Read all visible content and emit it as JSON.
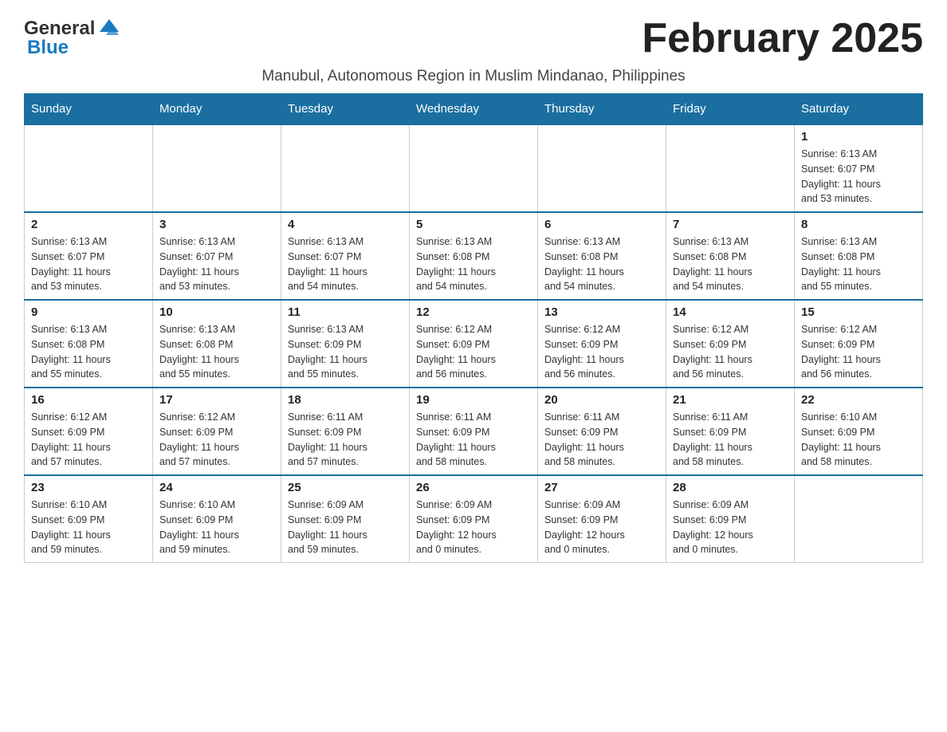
{
  "header": {
    "logo_general": "General",
    "logo_blue": "Blue",
    "month_year": "February 2025",
    "subtitle": "Manubul, Autonomous Region in Muslim Mindanao, Philippines"
  },
  "days_of_week": [
    "Sunday",
    "Monday",
    "Tuesday",
    "Wednesday",
    "Thursday",
    "Friday",
    "Saturday"
  ],
  "weeks": [
    [
      {
        "day": "",
        "info": ""
      },
      {
        "day": "",
        "info": ""
      },
      {
        "day": "",
        "info": ""
      },
      {
        "day": "",
        "info": ""
      },
      {
        "day": "",
        "info": ""
      },
      {
        "day": "",
        "info": ""
      },
      {
        "day": "1",
        "info": "Sunrise: 6:13 AM\nSunset: 6:07 PM\nDaylight: 11 hours\nand 53 minutes."
      }
    ],
    [
      {
        "day": "2",
        "info": "Sunrise: 6:13 AM\nSunset: 6:07 PM\nDaylight: 11 hours\nand 53 minutes."
      },
      {
        "day": "3",
        "info": "Sunrise: 6:13 AM\nSunset: 6:07 PM\nDaylight: 11 hours\nand 53 minutes."
      },
      {
        "day": "4",
        "info": "Sunrise: 6:13 AM\nSunset: 6:07 PM\nDaylight: 11 hours\nand 54 minutes."
      },
      {
        "day": "5",
        "info": "Sunrise: 6:13 AM\nSunset: 6:08 PM\nDaylight: 11 hours\nand 54 minutes."
      },
      {
        "day": "6",
        "info": "Sunrise: 6:13 AM\nSunset: 6:08 PM\nDaylight: 11 hours\nand 54 minutes."
      },
      {
        "day": "7",
        "info": "Sunrise: 6:13 AM\nSunset: 6:08 PM\nDaylight: 11 hours\nand 54 minutes."
      },
      {
        "day": "8",
        "info": "Sunrise: 6:13 AM\nSunset: 6:08 PM\nDaylight: 11 hours\nand 55 minutes."
      }
    ],
    [
      {
        "day": "9",
        "info": "Sunrise: 6:13 AM\nSunset: 6:08 PM\nDaylight: 11 hours\nand 55 minutes."
      },
      {
        "day": "10",
        "info": "Sunrise: 6:13 AM\nSunset: 6:08 PM\nDaylight: 11 hours\nand 55 minutes."
      },
      {
        "day": "11",
        "info": "Sunrise: 6:13 AM\nSunset: 6:09 PM\nDaylight: 11 hours\nand 55 minutes."
      },
      {
        "day": "12",
        "info": "Sunrise: 6:12 AM\nSunset: 6:09 PM\nDaylight: 11 hours\nand 56 minutes."
      },
      {
        "day": "13",
        "info": "Sunrise: 6:12 AM\nSunset: 6:09 PM\nDaylight: 11 hours\nand 56 minutes."
      },
      {
        "day": "14",
        "info": "Sunrise: 6:12 AM\nSunset: 6:09 PM\nDaylight: 11 hours\nand 56 minutes."
      },
      {
        "day": "15",
        "info": "Sunrise: 6:12 AM\nSunset: 6:09 PM\nDaylight: 11 hours\nand 56 minutes."
      }
    ],
    [
      {
        "day": "16",
        "info": "Sunrise: 6:12 AM\nSunset: 6:09 PM\nDaylight: 11 hours\nand 57 minutes."
      },
      {
        "day": "17",
        "info": "Sunrise: 6:12 AM\nSunset: 6:09 PM\nDaylight: 11 hours\nand 57 minutes."
      },
      {
        "day": "18",
        "info": "Sunrise: 6:11 AM\nSunset: 6:09 PM\nDaylight: 11 hours\nand 57 minutes."
      },
      {
        "day": "19",
        "info": "Sunrise: 6:11 AM\nSunset: 6:09 PM\nDaylight: 11 hours\nand 58 minutes."
      },
      {
        "day": "20",
        "info": "Sunrise: 6:11 AM\nSunset: 6:09 PM\nDaylight: 11 hours\nand 58 minutes."
      },
      {
        "day": "21",
        "info": "Sunrise: 6:11 AM\nSunset: 6:09 PM\nDaylight: 11 hours\nand 58 minutes."
      },
      {
        "day": "22",
        "info": "Sunrise: 6:10 AM\nSunset: 6:09 PM\nDaylight: 11 hours\nand 58 minutes."
      }
    ],
    [
      {
        "day": "23",
        "info": "Sunrise: 6:10 AM\nSunset: 6:09 PM\nDaylight: 11 hours\nand 59 minutes."
      },
      {
        "day": "24",
        "info": "Sunrise: 6:10 AM\nSunset: 6:09 PM\nDaylight: 11 hours\nand 59 minutes."
      },
      {
        "day": "25",
        "info": "Sunrise: 6:09 AM\nSunset: 6:09 PM\nDaylight: 11 hours\nand 59 minutes."
      },
      {
        "day": "26",
        "info": "Sunrise: 6:09 AM\nSunset: 6:09 PM\nDaylight: 12 hours\nand 0 minutes."
      },
      {
        "day": "27",
        "info": "Sunrise: 6:09 AM\nSunset: 6:09 PM\nDaylight: 12 hours\nand 0 minutes."
      },
      {
        "day": "28",
        "info": "Sunrise: 6:09 AM\nSunset: 6:09 PM\nDaylight: 12 hours\nand 0 minutes."
      },
      {
        "day": "",
        "info": ""
      }
    ]
  ]
}
